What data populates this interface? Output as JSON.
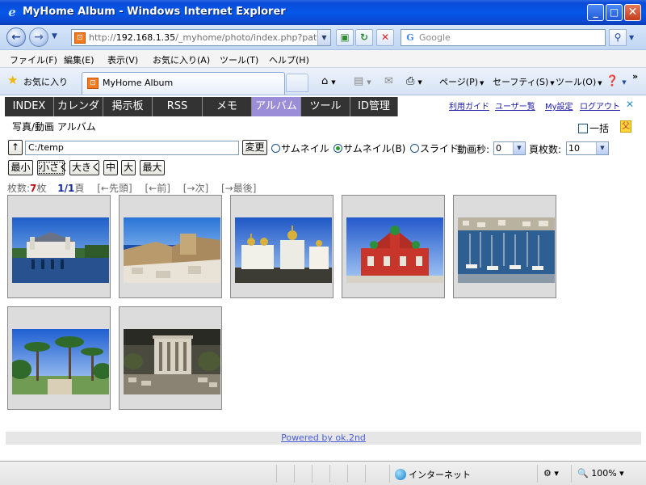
{
  "window": {
    "title": "MyHome Album - Windows Internet Explorer",
    "buttons": {
      "minimize": "_",
      "maximize": "□",
      "close": "✕"
    }
  },
  "addressbar": {
    "url_prefix": "http://",
    "url_host": "192.168.1.35",
    "url_path": "/_myhome/photo/index.php?path=C%",
    "search_placeholder": "Google"
  },
  "menu": [
    "ファイル(F)",
    "編集(E)",
    "表示(V)",
    "お気に入り(A)",
    "ツール(T)",
    "ヘルプ(H)"
  ],
  "favorites_bar": {
    "favorites_label": "お気に入り",
    "tab_title": "MyHome Album",
    "commands": {
      "page": "ページ(P)",
      "safety": "セーフティ(S)",
      "tools": "ツール(O)",
      "more": "»"
    }
  },
  "site": {
    "nav": [
      {
        "label": "INDEX",
        "active": false
      },
      {
        "label": "カレンダ",
        "active": false
      },
      {
        "label": "掲示板",
        "active": false
      },
      {
        "label": "RSS",
        "active": false
      },
      {
        "label": "メモ",
        "active": false
      },
      {
        "label": "アルバム",
        "active": true
      },
      {
        "label": "ツール",
        "active": false
      },
      {
        "label": "ID管理",
        "active": false
      }
    ],
    "top_links": [
      "利用ガイド",
      "ユーザー覧",
      "My設定",
      "ログアウト"
    ],
    "page_title": "写真/動画 アルバム",
    "bulk_label": "一括",
    "up_button": "↑",
    "path_value": "C:/temp",
    "change_button": "変更",
    "view_modes": [
      {
        "label": "サムネイル",
        "selected": false
      },
      {
        "label": "サムネイル(B)",
        "selected": true
      },
      {
        "label": "スライド",
        "selected": false
      }
    ],
    "video_seconds_label": "動画秒:",
    "video_seconds_value": "0",
    "per_page_label": "頁枚数:",
    "per_page_value": "10",
    "size_buttons": [
      "最小",
      "小さく",
      "大きく",
      "中",
      "大",
      "最大"
    ],
    "count": {
      "label": "枚数:",
      "value": "7",
      "unit": "枚",
      "page_current": "1",
      "page_sep": "/",
      "page_total": "1",
      "page_unit": "頁",
      "nav": [
        "[←先頭]",
        "[←前]",
        "[→次]",
        "[→最後]"
      ]
    },
    "thumbnails": [
      {
        "scene": "chateau-river",
        "colors": [
          "#2c6fd0",
          "#8ec3f2",
          "#ffffff",
          "#3a6b34"
        ]
      },
      {
        "scene": "ruins-sea",
        "colors": [
          "#3a85e0",
          "#b9d9f7",
          "#cbb58e",
          "#e9e2d6"
        ]
      },
      {
        "scene": "kremlin-cathedrals",
        "colors": [
          "#2f6ad6",
          "#a6c8f2",
          "#f1f1ea",
          "#3c3c34"
        ]
      },
      {
        "scene": "red-church",
        "colors": [
          "#2a63d2",
          "#9ec4f3",
          "#c8352a",
          "#e8e4da"
        ]
      },
      {
        "scene": "harbor-boats",
        "colors": [
          "#3b77cf",
          "#a7c6ea",
          "#dedad2",
          "#2e4f7a"
        ]
      },
      {
        "scene": "palm-garden",
        "colors": [
          "#2d6fd8",
          "#b3d3f6",
          "#2f6a2a",
          "#8fb86a"
        ]
      },
      {
        "scene": "ancient-library-ruins",
        "colors": [
          "#2a2a24",
          "#7a7062",
          "#d8d2c4",
          "#4e5a36"
        ]
      }
    ],
    "powered_by": "Powered by ok.2nd"
  },
  "statusbar": {
    "zone": "インターネット",
    "zoom": "100%"
  }
}
